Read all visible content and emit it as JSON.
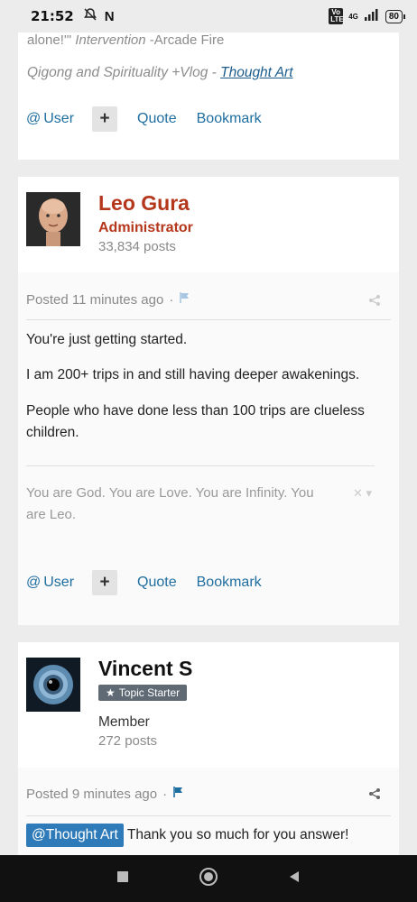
{
  "status": {
    "time": "21:52",
    "lte": "Vo LTE",
    "network": "4G",
    "battery": "80"
  },
  "post1": {
    "quote_tail_prefix": "alone!'\" ",
    "quote_tail_title": "Intervention",
    "quote_tail_suffix": " -Arcade Fire",
    "signature_text": "Qigong and Spirituality +Vlog - ",
    "signature_link": "Thought Art",
    "actions": {
      "user": "User",
      "quote": "Quote",
      "bookmark": "Bookmark"
    }
  },
  "post2": {
    "author": "Leo Gura",
    "role": "Administrator",
    "post_count": "33,834 posts",
    "posted": "Posted 11 minutes ago",
    "paragraphs": [
      "You're just getting started.",
      "I am 200+ trips in and still having deeper awakenings.",
      "People who have done less than 100 trips are clueless children."
    ],
    "signature": "You are God. You are Love. You are Infinity. You are Leo.",
    "actions": {
      "user": "User",
      "quote": "Quote",
      "bookmark": "Bookmark"
    }
  },
  "post3": {
    "author": "Vincent S",
    "badge": "Topic Starter",
    "member_title": "Member",
    "post_count": "272 posts",
    "posted": "Posted 9 minutes ago",
    "mention": "@Thought Art",
    "text": " Thank you so much for you answer!"
  },
  "colors": {
    "accent": "#1f6ea0",
    "admin_name": "#b5371b",
    "mention_tag": "#2f7ab8",
    "badge": "#5f6a75"
  }
}
